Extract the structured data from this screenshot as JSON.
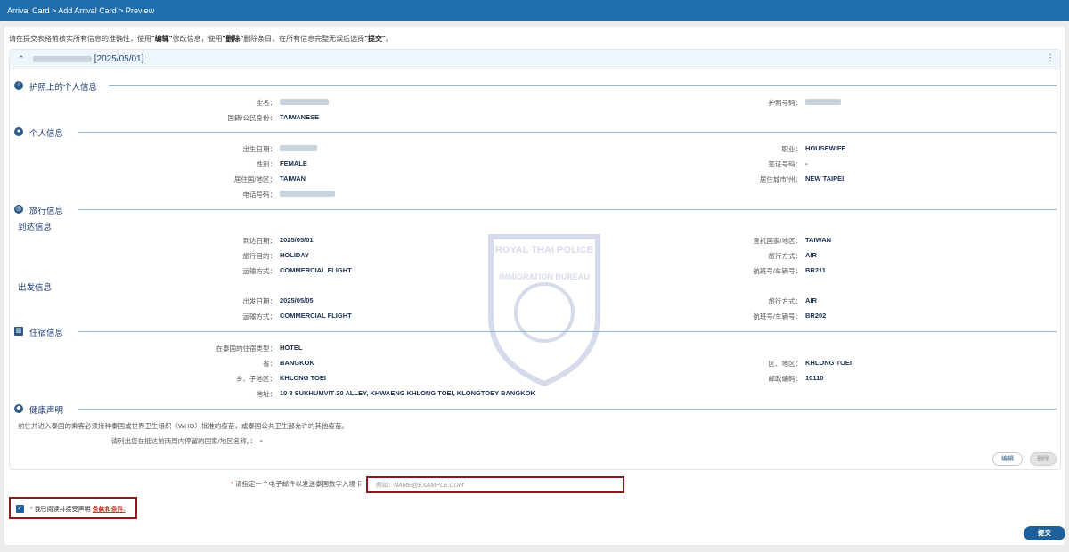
{
  "breadcrumb": "Arrival Card > Add Arrival Card > Preview",
  "intro": {
    "part1": "请在提交表格前核实所有信息的准确性，使用",
    "edit_quote": "\"编辑\"",
    "part2": "修改信息，使用",
    "delete_quote": "\"删除\"",
    "part3": "删除条目，在所有信息完整无误后选择",
    "submit_quote": "\"提交\"",
    "part4": "。"
  },
  "card": {
    "title_date": "[2025/05/01]"
  },
  "sections": {
    "passport": "护照上的个人信息",
    "personal": "个人信息",
    "travel": "旅行信息",
    "arrival": "到达信息",
    "departure": "出发信息",
    "accommodation": "住宿信息",
    "health": "健康声明"
  },
  "passport": {
    "fullname_label": "全名：",
    "passport_no_label": "护照号码：",
    "nationality_label": "国籍/公民身份：",
    "nationality": "TAIWANESE"
  },
  "personal": {
    "dob_label": "出生日期：",
    "occupation_label": "职业：",
    "occupation": "HOUSEWIFE",
    "gender_label": "性别：",
    "gender": "FEMALE",
    "visa_label": "签证号码：",
    "visa": "-",
    "residence_country_label": "居住国/地区：",
    "residence_country": "TAIWAN",
    "residence_city_label": "居住城市/州：",
    "residence_city": "NEW TAIPEI",
    "phone_label": "电话号码："
  },
  "arrival": {
    "date_label": "到达日期：",
    "date": "2025/05/01",
    "boarding_label": "登机国家/地区：",
    "boarding": "TAIWAN",
    "purpose_label": "旅行目的：",
    "purpose": "HOLIDAY",
    "mode_label": "旅行方式：",
    "mode": "AIR",
    "transport_label": "运输方式：",
    "transport": "COMMERCIAL FLIGHT",
    "flight_label": "航班号/车辆号：",
    "flight": "BR211"
  },
  "departure": {
    "date_label": "出发日期：",
    "date": "2025/05/05",
    "mode_label": "旅行方式：",
    "mode": "AIR",
    "transport_label": "运输方式：",
    "transport": "COMMERCIAL FLIGHT",
    "flight_label": "航班号/车辆号：",
    "flight": "BR202"
  },
  "accommodation": {
    "type_label": "在泰国的住宿类型：",
    "type": "HOTEL",
    "province_label": "省：",
    "province": "BANGKOK",
    "district_label": "区、地区：",
    "district": "KHLONG TOEI",
    "subdistrict_label": "乡、子地区：",
    "subdistrict": "KHLONG TOEI",
    "postcode_label": "邮政编码：",
    "postcode": "10110",
    "address_label": "地址：",
    "address": "10 3 SUKHUMVIT 20 ALLEY, KHWAENG KHLONG TOEI, KLONGTOEY BANGKOK"
  },
  "health": {
    "notice": "前往并进入泰国的乘客必须接种泰国或世界卫生组织（WHO）批准的疫苗，或泰国公共卫生部允许的其他疫苗。",
    "countries_label": "请列出您在抵达前两周内停留的国家/地区名称。：",
    "countries": "-"
  },
  "buttons": {
    "edit": "编辑",
    "delete": "删除",
    "submit": "提交"
  },
  "email": {
    "required_mark": "*",
    "label": "请指定一个电子邮件以发送泰国数字入境卡",
    "placeholder": "例如：NAME@EXAMPLE.COM"
  },
  "terms": {
    "required_mark": "*",
    "text": "我已阅读并接受声明",
    "link": "条款和条件."
  },
  "watermark": {
    "top_text": "ROYAL THAI POLICE",
    "mid_text": "IMMIGRATION BUREAU"
  },
  "colors": {
    "header": "#1f6fae",
    "accent": "#1f5f9a",
    "required": "#c0392b",
    "highlight_border": "#8b1a1a"
  }
}
